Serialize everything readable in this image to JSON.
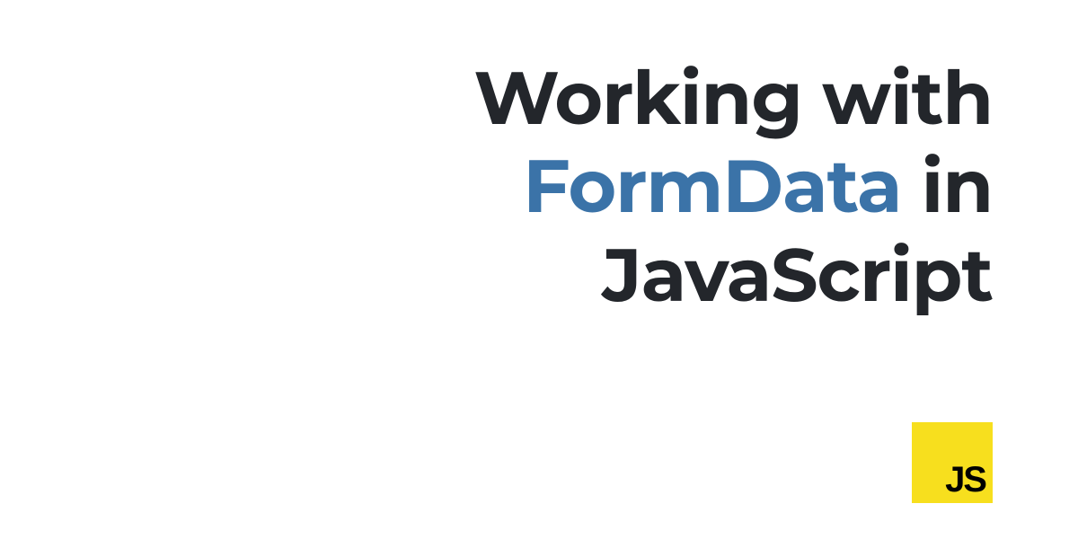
{
  "heading": {
    "line1_prefix": "Working with",
    "line2_highlight": "FormData",
    "line2_suffix": " in",
    "line3": "JavaScript"
  },
  "logo": {
    "text": "JS",
    "background_color": "#f7df1e",
    "text_color": "#000000"
  },
  "colors": {
    "text_primary": "#23262b",
    "text_highlight": "#3b73a8",
    "background": "#ffffff"
  }
}
